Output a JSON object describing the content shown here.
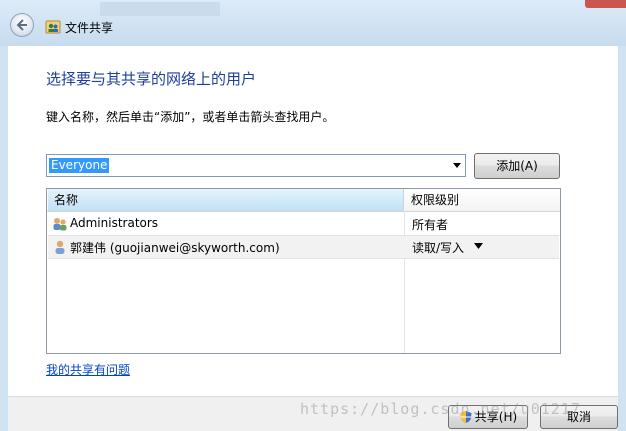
{
  "window": {
    "title": "文件共享",
    "back_icon": "back-arrow-icon",
    "title_icon": "file-share-icon"
  },
  "main": {
    "heading": "选择要与其共享的网络上的用户",
    "instruction": "键入名称，然后单击“添加”，或者单击箭头查找用户。",
    "name_input_value": "Everyone",
    "add_button_label": "添加(A)",
    "table": {
      "columns": [
        "名称",
        "权限级别"
      ],
      "rows": [
        {
          "icon": "users-group-icon",
          "name": "Administrators",
          "permission": "所有者"
        },
        {
          "icon": "user-icon",
          "name": "郭建伟 (guojianwei@skyworth.com)",
          "permission": "读取/写入"
        }
      ]
    },
    "help_link": "我的共享有问题"
  },
  "footer": {
    "share_button_label": "共享(H)",
    "cancel_button_label": "取消"
  },
  "watermark": "https://blog.csdn.net/u01217"
}
